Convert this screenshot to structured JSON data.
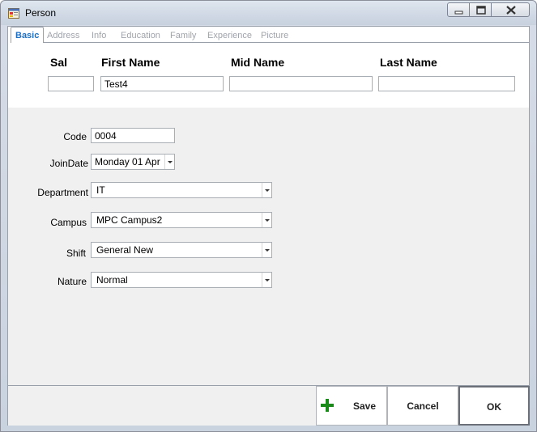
{
  "window": {
    "title": "Person"
  },
  "tabs": [
    "Basic",
    "Address",
    "Info",
    "Education",
    "Family",
    "Experience",
    "Picture"
  ],
  "name_panel": {
    "sal_label": "Sal",
    "first_name_label": "First Name",
    "mid_name_label": "Mid Name",
    "last_name_label": "Last Name",
    "sal_value": "",
    "first_name_value": "Test4",
    "mid_name_value": "",
    "last_name_value": ""
  },
  "form": {
    "code_label": "Code",
    "code_value": "0004",
    "joindate_label": "JoinDate",
    "joindate_value": "Monday 01 Apr",
    "department_label": "Department",
    "department_value": "IT",
    "campus_label": "Campus",
    "campus_value": "MPC Campus2",
    "shift_label": "Shift",
    "shift_value": "General New",
    "nature_label": "Nature",
    "nature_value": "Normal"
  },
  "buttons": {
    "save": "Save",
    "cancel": "Cancel",
    "ok": "OK"
  },
  "icons": {
    "app": "form-window-icon",
    "minimize": "minimize-icon",
    "maximize": "restore-icon",
    "close": "close-icon",
    "save": "plus-icon"
  },
  "colors": {
    "active_tab": "#1f6fc4",
    "save_plus": "#1a8a1a"
  }
}
